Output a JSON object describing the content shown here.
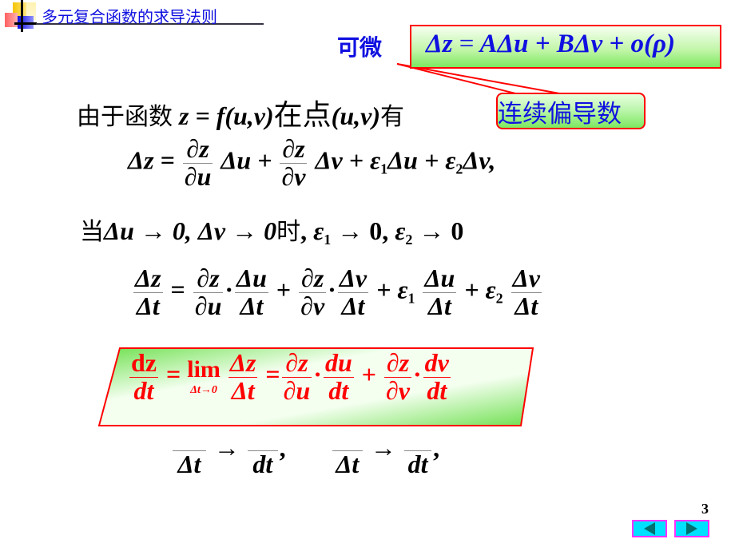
{
  "header": {
    "title": "多元复合函数的求导法则"
  },
  "callouts": {
    "differentiable_label": "可微",
    "differentiable_formula": {
      "lhs": "Δz",
      "eq": "=",
      "rhs": "AΔu + BΔv + o(ρ)"
    },
    "continuous_partials_label": "连续偏导数"
  },
  "line1": {
    "prefix": "由于函数",
    "function": "z = f(u,v)",
    "at_point": "在点",
    "point": "(u,v)",
    "has": "有"
  },
  "line2": {
    "lhs": "Δz =",
    "frac1_num": "∂z",
    "frac1_den": "∂u",
    "term1": "Δu +",
    "frac2_num": "∂z",
    "frac2_den": "∂v",
    "term2": "Δv + ",
    "eps1": "ε",
    "eps1_sub": "1",
    "term3": "Δu + ",
    "eps2": "ε",
    "eps2_sub": "2",
    "term4": "Δv,"
  },
  "line3": {
    "when": "当",
    "cond1": "Δu → 0, Δv → 0",
    "time": "时",
    "comma": ",",
    "eps1": "ε",
    "eps1_sub": "1",
    "arrow1": " → 0, ",
    "eps2": "ε",
    "eps2_sub": "2",
    "arrow2": " → 0"
  },
  "line4": {
    "lhs_num": "Δz",
    "lhs_den": "Δt",
    "eq": "=",
    "f1_num": "∂z",
    "f1_den": "∂u",
    "dot": "·",
    "f2_num": "Δu",
    "f2_den": "Δt",
    "plus": "+",
    "f3_num": "∂z",
    "f3_den": "∂v",
    "f4_num": "Δv",
    "f4_den": "Δt",
    "plus_eps1": "+ ε",
    "eps1_sub": "1",
    "f5_num": "Δu",
    "f5_den": "Δt",
    "plus_eps2": "+ ε",
    "eps2_sub": "2",
    "f6_num": "Δv",
    "f6_den": "Δt"
  },
  "lower_row": {
    "f1_den": "Δt",
    "arrow": "→",
    "f2_den": "dt",
    "comma": ",",
    "f3_den": "Δt",
    "f4_den": "dt"
  },
  "chain_rule": {
    "lhs_num": "dz",
    "lhs_den": "dt",
    "eq": "=",
    "lim": "lim",
    "lim_sub": "Δt→0",
    "f1_num": "Δz",
    "f1_den": "Δt",
    "f2_num": "∂z",
    "f2_den": "∂u",
    "dot": "·",
    "f3_num": "du",
    "f3_den": "dt",
    "plus": "+",
    "f4_num": "∂z",
    "f4_den": "∂v",
    "f5_num": "dv",
    "f5_den": "dt"
  },
  "footer": {
    "page_number": "3",
    "prev_icon": "triangle-left",
    "next_icon": "triangle-right"
  },
  "colors": {
    "title_blue": "#1010e0",
    "highlight_red": "#ff0000",
    "box_green": "#7ce860",
    "nav_cyan": "#00e0ff",
    "nav_border": "#ff30ff"
  }
}
